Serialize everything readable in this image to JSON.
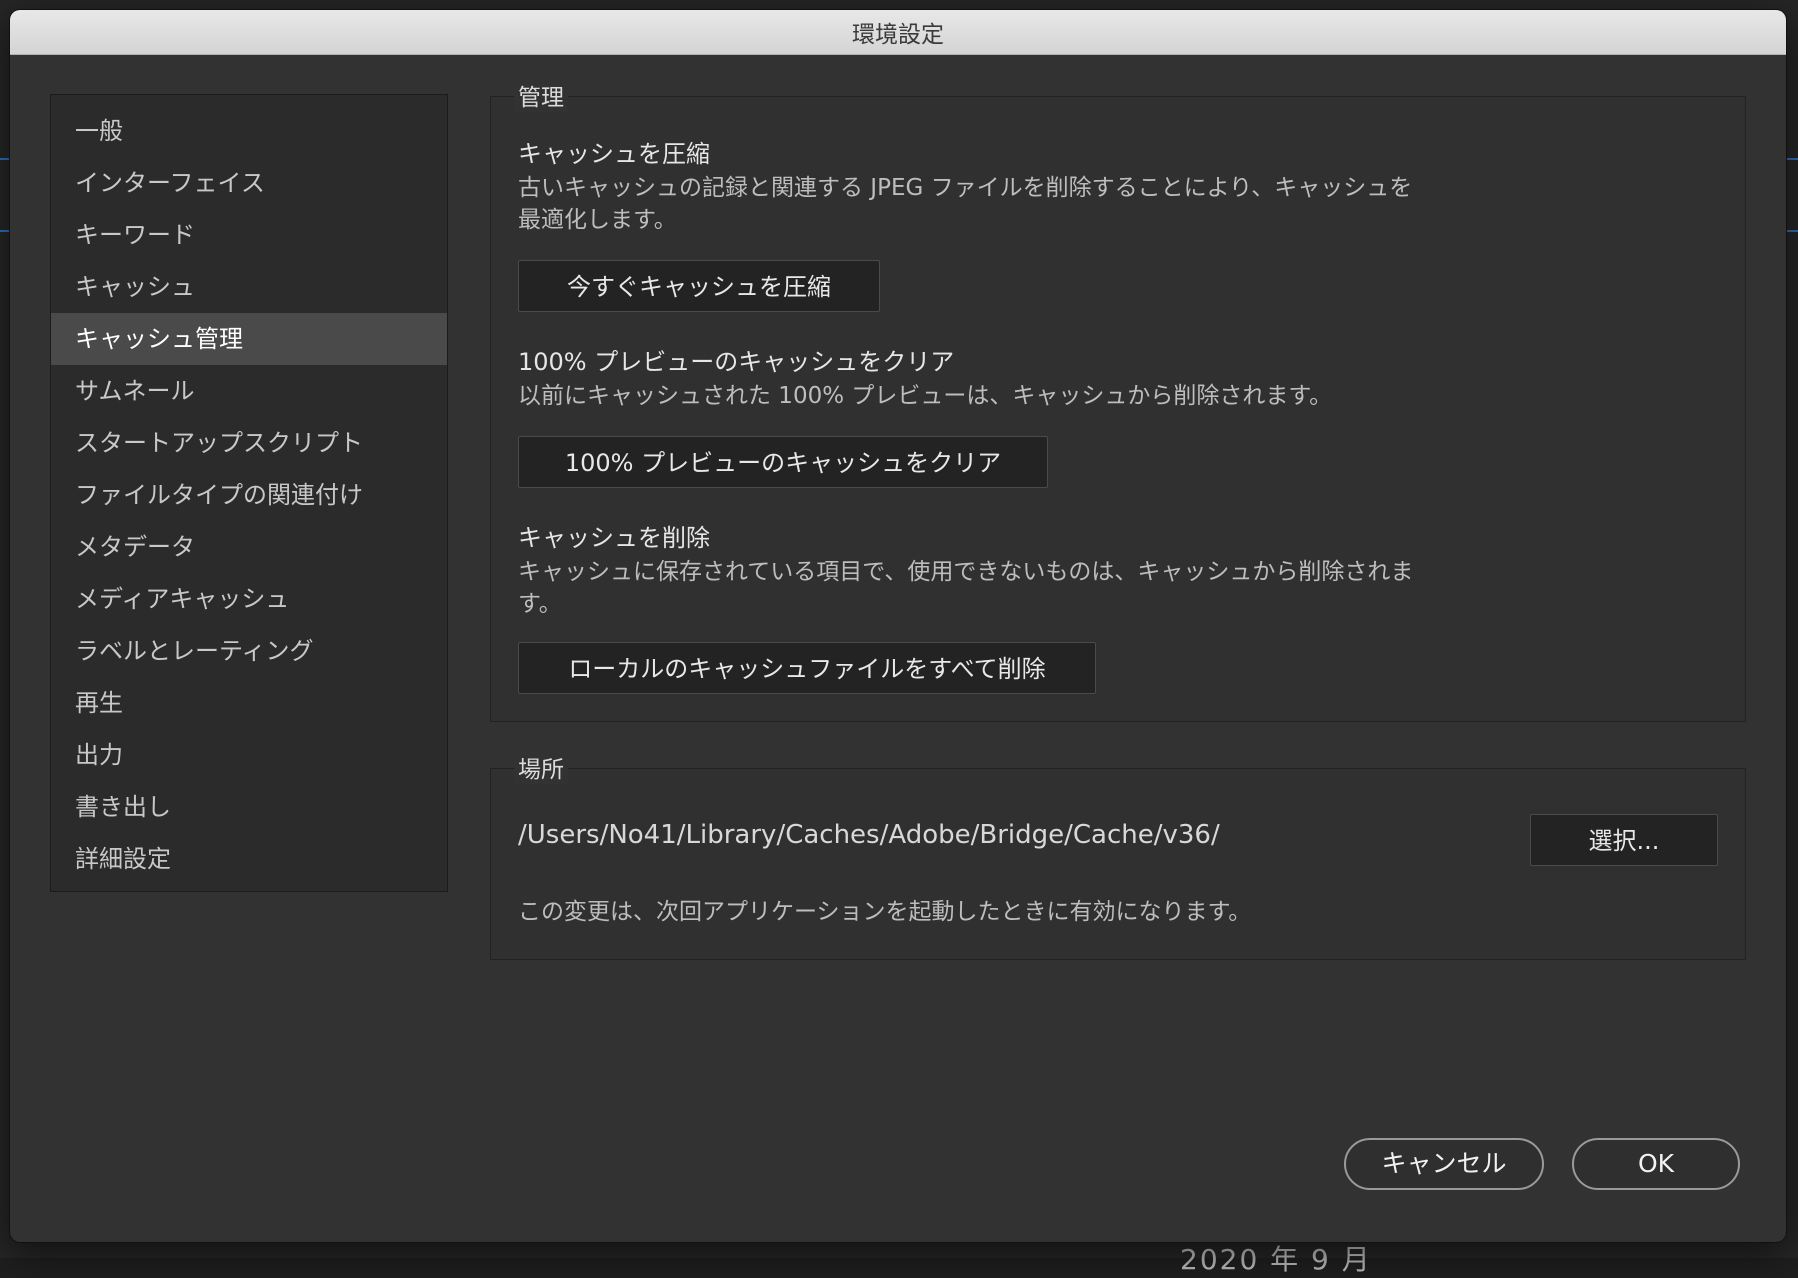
{
  "dialog": {
    "title": "環境設定"
  },
  "sidebar": {
    "items": [
      {
        "label": "一般"
      },
      {
        "label": "インターフェイス"
      },
      {
        "label": "キーワード"
      },
      {
        "label": "キャッシュ"
      },
      {
        "label": "キャッシュ管理",
        "selected": true
      },
      {
        "label": "サムネール"
      },
      {
        "label": "スタートアップスクリプト"
      },
      {
        "label": "ファイルタイプの関連付け"
      },
      {
        "label": "メタデータ"
      },
      {
        "label": "メディアキャッシュ"
      },
      {
        "label": "ラベルとレーティング"
      },
      {
        "label": "再生"
      },
      {
        "label": "出力"
      },
      {
        "label": "書き出し"
      },
      {
        "label": "詳細設定"
      }
    ]
  },
  "manage": {
    "title": "管理",
    "compact": {
      "title": "キャッシュを圧縮",
      "desc": "古いキャッシュの記録と関連する JPEG ファイルを削除することにより、キャッシュを最適化します。",
      "button": "今すぐキャッシュを圧縮"
    },
    "clear_preview": {
      "title": "100% プレビューのキャッシュをクリア",
      "desc": "以前にキャッシュされた 100% プレビューは、キャッシュから削除されます。",
      "button": "100% プレビューのキャッシュをクリア"
    },
    "purge": {
      "title": "キャッシュを削除",
      "desc": "キャッシュに保存されている項目で、使用できないものは、キャッシュから削除されます。",
      "button": "ローカルのキャッシュファイルをすべて削除"
    }
  },
  "location": {
    "title": "場所",
    "path": "/Users/No41/Library/Caches/Adobe/Bridge/Cache/v36/",
    "choose_button": "選択...",
    "note": "この変更は、次回アプリケーションを起動したときに有効になります。"
  },
  "footer": {
    "cancel": "キャンセル",
    "ok": "OK"
  },
  "background": {
    "date_fragment": "2020 年 9 月"
  }
}
